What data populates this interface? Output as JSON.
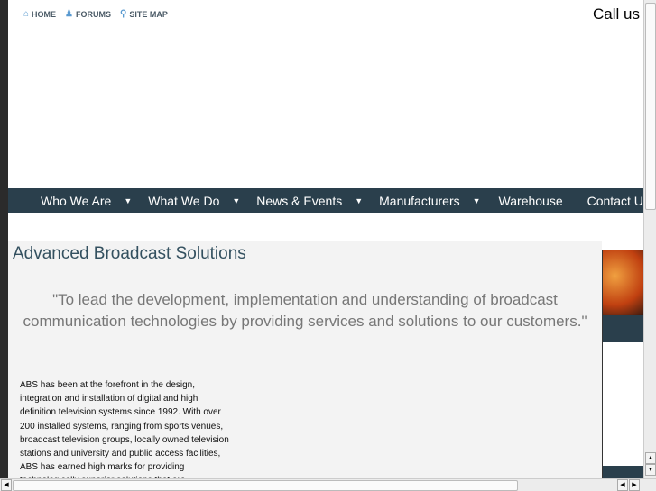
{
  "toplinks": [
    {
      "label": "HOME",
      "icon": "home-icon"
    },
    {
      "label": "FORUMS",
      "icon": "users-icon"
    },
    {
      "label": "SITE MAP",
      "icon": "search-icon"
    }
  ],
  "callus": "Call us",
  "nav": [
    {
      "label": "Who We Are",
      "dropdown": true
    },
    {
      "label": "What We Do",
      "dropdown": true
    },
    {
      "label": "News & Events",
      "dropdown": true
    },
    {
      "label": "Manufacturers",
      "dropdown": true
    },
    {
      "label": "Warehouse",
      "dropdown": false
    },
    {
      "label": "Contact Us",
      "dropdown": false
    }
  ],
  "main": {
    "title": "Advanced Broadcast Solutions",
    "quote": "\"To lead the development, implementation and understanding of broadcast communication technologies by providing services and solutions to our customers.\"",
    "body": "ABS has been at the forefront in the design, integration and installation of digital and high definition television systems since 1992. With over 200 installed systems, ranging from sports venues, broadcast television groups, locally owned television stations and university and public access facilities, ABS has earned high marks for providing technologically superior solutions that are"
  },
  "colors": {
    "nav": "#2a3f4c",
    "title": "#33505f"
  }
}
